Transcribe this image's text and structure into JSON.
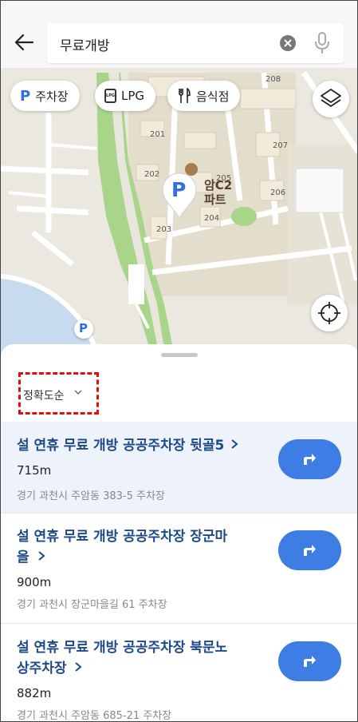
{
  "search": {
    "query": "무료개방"
  },
  "chips": {
    "parking_icon": "P",
    "parking_label": "주차장",
    "lpg_icon_text": "LPG",
    "lpg_label": "LPG",
    "food_label": "음식점"
  },
  "map": {
    "buildings": [
      "208",
      "201",
      "207",
      "202",
      "205",
      "206",
      "204",
      "203"
    ],
    "apartment_label_line1": "암C2",
    "apartment_label_line2": "파트",
    "marker_letter": "P",
    "small_marker_letter": "P"
  },
  "sheet": {
    "sort_label": "정확도순"
  },
  "results": [
    {
      "title": "설 연휴 무료 개방 공공주차장 뒷골5",
      "distance": "715m",
      "address": "경기 과천시 주암동 383-5 주차장",
      "selected": true
    },
    {
      "title_line1": "설 연휴 무료 개방 공공주차장 장군마",
      "title_line2": "을",
      "distance": "900m",
      "address": "경기 과천시 장군마을길 61 주차장",
      "selected": false
    },
    {
      "title_line1": "설 연휴 무료 개방 공공주차장 북문노",
      "title_line2": "상주차장",
      "distance": "882m",
      "address": "경기 과천시 주암동 685-21 주차장",
      "selected": false
    }
  ],
  "colors": {
    "accent": "#3d7de4",
    "title_blue": "#1c4a88",
    "selected_bg": "#eef3fb",
    "highlight_box": "#e01010"
  }
}
